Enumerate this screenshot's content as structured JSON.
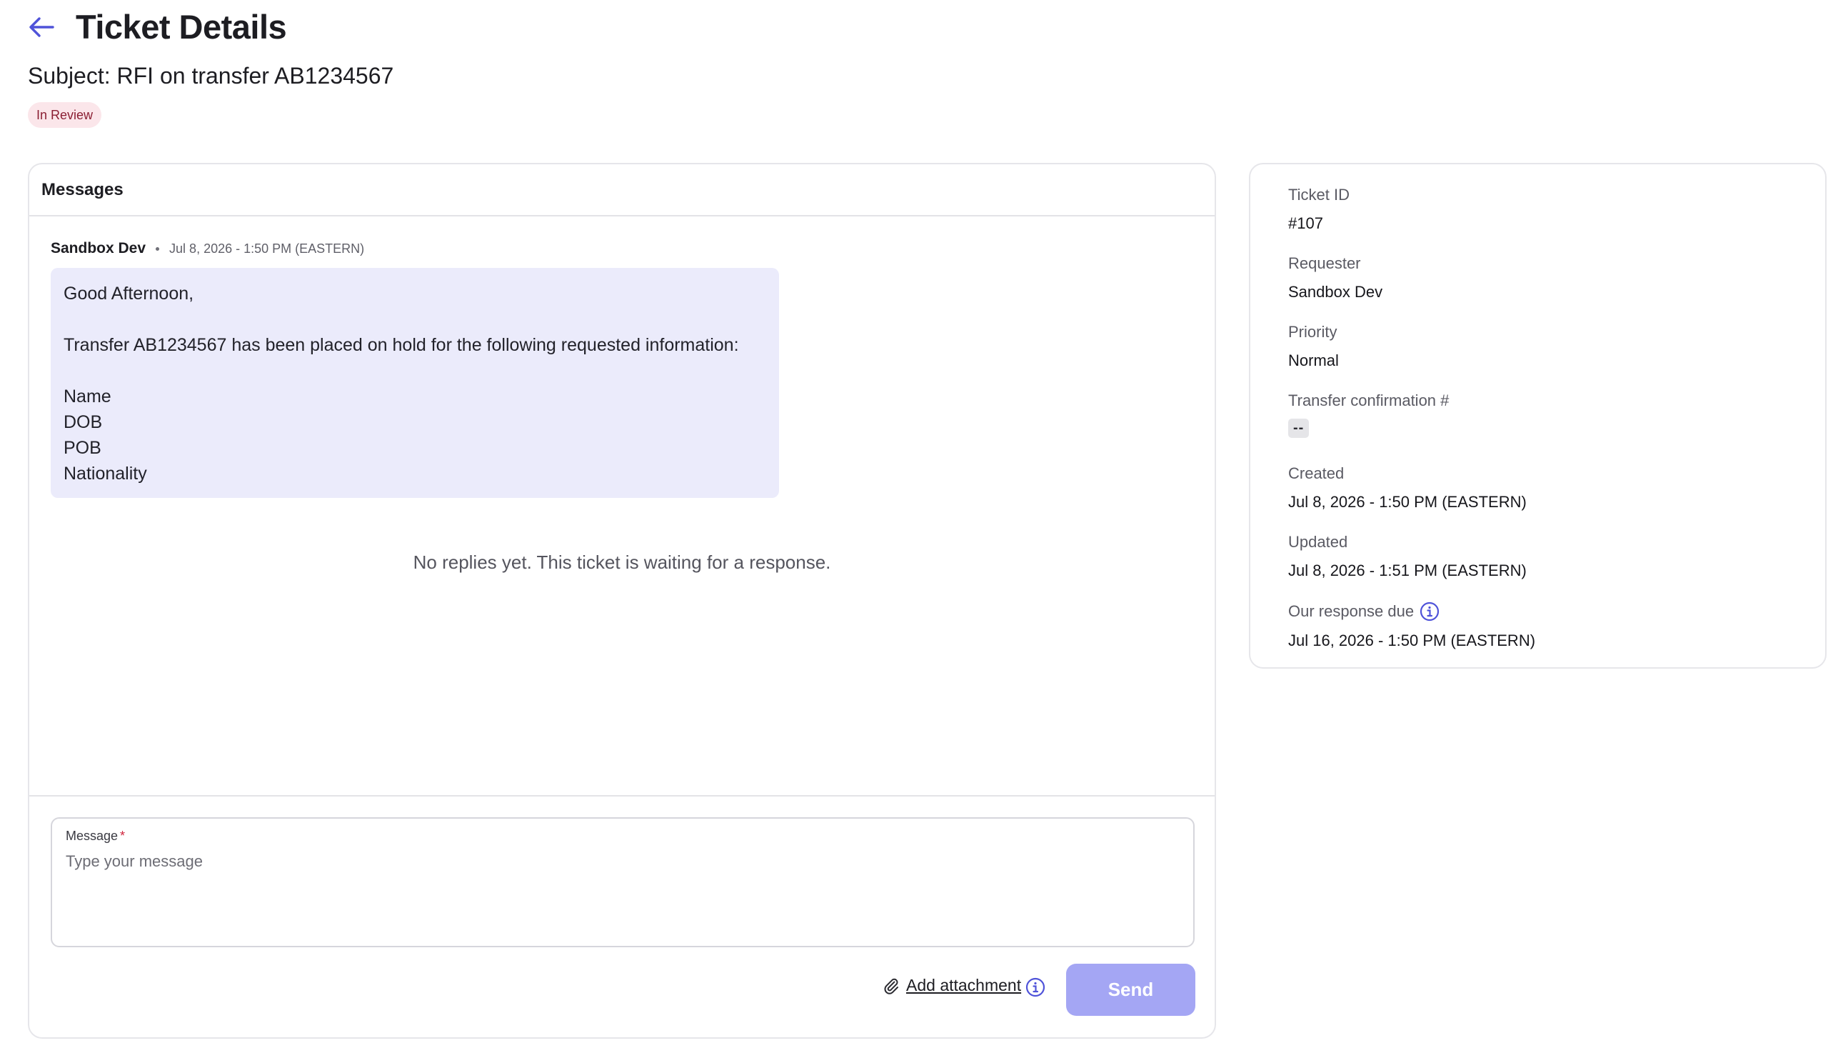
{
  "header": {
    "title": "Ticket Details"
  },
  "ticket": {
    "subject": "Subject: RFI on transfer AB1234567",
    "status": "In Review"
  },
  "messages": {
    "title": "Messages",
    "items": [
      {
        "author": "Sandbox Dev",
        "timestamp": "Jul 8, 2026 - 1:50 PM (EASTERN)",
        "lines": {
          "greeting": "Good Afternoon,",
          "body": "Transfer AB1234567 has been placed on hold for the following requested information:",
          "item1": "Name",
          "item2": "DOB",
          "item3": "POB",
          "item4": "Nationality"
        }
      }
    ],
    "empty_state": "No replies yet. This ticket is waiting for a response."
  },
  "compose": {
    "label": "Message",
    "required_mark": "*",
    "placeholder": "Type your message",
    "attach_label": "Add attachment",
    "send_label": "Send"
  },
  "details": {
    "ticket_id": {
      "label": "Ticket ID",
      "value": "#107"
    },
    "requester": {
      "label": "Requester",
      "value": "Sandbox Dev"
    },
    "priority": {
      "label": "Priority",
      "value": "Normal"
    },
    "transfer_confirmation": {
      "label": "Transfer confirmation #",
      "value": "--"
    },
    "created": {
      "label": "Created",
      "value": "Jul 8, 2026 - 1:50 PM (EASTERN)"
    },
    "updated": {
      "label": "Updated",
      "value": "Jul 8, 2026 - 1:51 PM (EASTERN)"
    },
    "response_due": {
      "label": "Our response due",
      "value": "Jul 16, 2026 - 1:50 PM (EASTERN)"
    }
  },
  "colors": {
    "accent": "#4f53d9",
    "send_button": "#a4a6f4",
    "status_badge_bg": "#fbe6ea",
    "status_badge_text": "#8b1f33",
    "message_bubble": "#ebebfb"
  },
  "icons": {
    "back": "arrow-left-icon",
    "attach": "paperclip-icon",
    "info": "info-icon"
  }
}
